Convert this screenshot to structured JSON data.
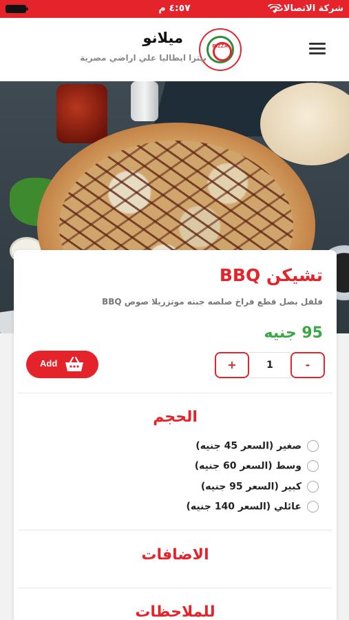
{
  "status_bar": {
    "carrier": "شركة الاتصالات",
    "time": "٤:٥٧ م"
  },
  "header": {
    "store_name": "ميلانو",
    "tagline": "بيتزا ايطاليا علي اراضي مصرية",
    "logo_text": "PIZZA"
  },
  "product": {
    "title": "تشيكن BBQ",
    "description": "فلفل بصل قطع فراخ صلصه جبنه موتزريلا صوص BBQ",
    "price": "95 جنيه"
  },
  "quantity": {
    "plus_label": "+",
    "value": "1",
    "minus_label": "-"
  },
  "add_button": {
    "label": "Add"
  },
  "size_section": {
    "title": "الحجم",
    "options": [
      {
        "label": "صغير (السعر 45 جنيه)"
      },
      {
        "label": "وسط (السعر 60 جنيه)"
      },
      {
        "label": "كبير (السعر 95 جنيه)"
      },
      {
        "label": "عائلي (السعر 140 جنيه)"
      }
    ]
  },
  "extras_section": {
    "title": "الاضافات"
  },
  "notes_section": {
    "title": "للملاحظات"
  },
  "colors": {
    "accent": "#e4232a",
    "price": "#3aa845"
  }
}
